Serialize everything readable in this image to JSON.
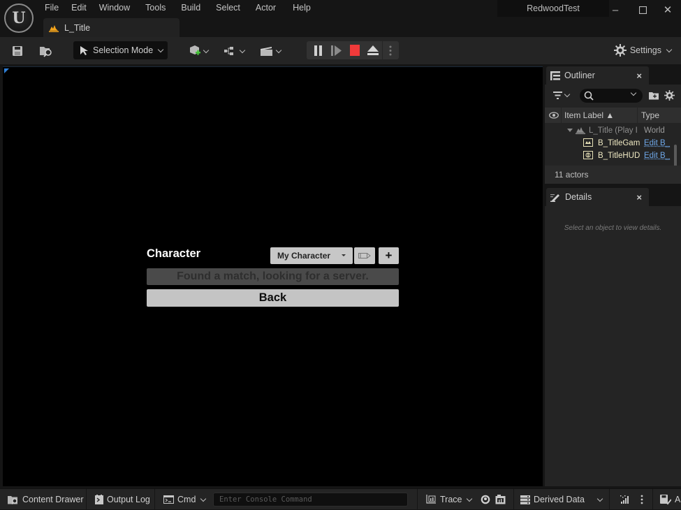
{
  "titlebar": {
    "menu": [
      "File",
      "Edit",
      "Window",
      "Tools",
      "Build",
      "Select",
      "Actor",
      "Help"
    ],
    "level_tab": "L_Title",
    "project_name": "RedwoodTest",
    "window_controls": {
      "minimize": "–",
      "maximize": "☐",
      "close": "✕"
    }
  },
  "toolbar": {
    "selection_mode": "Selection Mode",
    "settings": "Settings",
    "icons": [
      "save-icon",
      "browse-icon",
      "add-actor-icon",
      "blueprint-icon",
      "cinematics-icon",
      "pause-icon",
      "step-icon",
      "stop-icon",
      "eject-icon",
      "more-icon",
      "settings-icon"
    ],
    "colors": {
      "stop": "#f03a3a",
      "accent": "#2f7fd6"
    }
  },
  "viewport": {
    "game_ui": {
      "character_label": "Character",
      "character_dropdown": "My Character",
      "edit_icon": "✐",
      "add_label": "+",
      "status_text": "Found a match, looking for a server.",
      "back_label": "Back"
    }
  },
  "outliner": {
    "tab_label": "Outliner",
    "close": "×",
    "columns": {
      "label": "Item Label ▲",
      "type": "Type"
    },
    "rows": [
      {
        "label": "L_Title (Play I",
        "type": "World",
        "level": 0
      },
      {
        "label": "B_TitleGam",
        "type": "Edit B_",
        "level": 1
      },
      {
        "label": "B_TitleHUD",
        "type": "Edit B_",
        "level": 1
      }
    ],
    "actor_count": "11 actors"
  },
  "details": {
    "tab_label": "Details",
    "close": "×",
    "empty_text": "Select an object to view details."
  },
  "bottombar": {
    "content_drawer": "Content Drawer",
    "output_log": "Output Log",
    "cmd": "Cmd",
    "console_placeholder": "Enter Console Command",
    "trace": "Trace",
    "derived_data": "Derived Data",
    "all_saved": "Al"
  }
}
